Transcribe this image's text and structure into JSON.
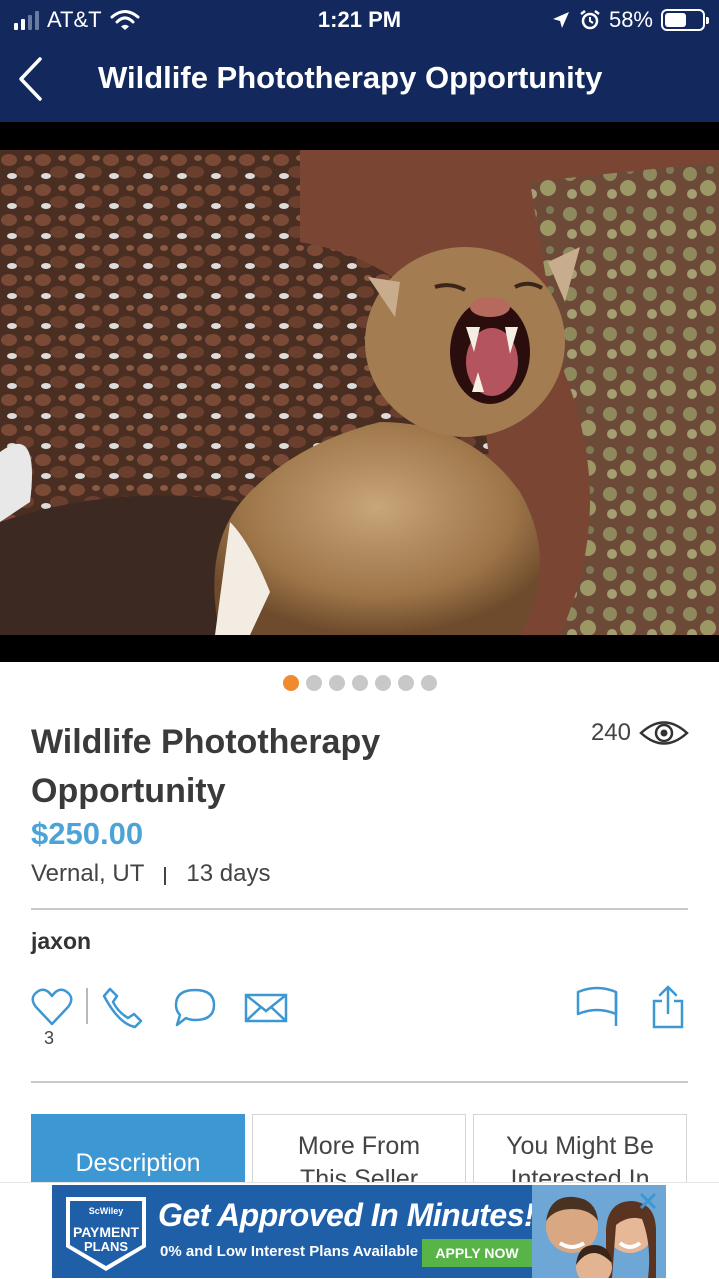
{
  "status_bar": {
    "carrier": "AT&T",
    "time": "1:21 PM",
    "battery": "58%",
    "battery_level": 0.58
  },
  "nav": {
    "title": "Wildlife Phototherapy Opportunity",
    "back_icon": "chevron-left-icon"
  },
  "gallery": {
    "image_count": 7,
    "active_index": 0
  },
  "listing": {
    "title": "Wildlife Phototherapy Opportunity",
    "views": "240",
    "price": "$250.00",
    "location": "Vernal, UT",
    "age": "13 days",
    "seller": "jaxon",
    "favorites": "3"
  },
  "actions": {
    "icons": [
      "heart-icon",
      "phone-icon",
      "chat-icon",
      "mail-icon",
      "flag-icon",
      "share-icon"
    ]
  },
  "tabs": [
    {
      "label": "Description",
      "active": true
    },
    {
      "label": "More From This Seller",
      "active": false
    },
    {
      "label": "You Might Be Interested In",
      "active": false
    }
  ],
  "ad": {
    "logo_top": "ScWiley",
    "logo_line1": "PAYMENT",
    "logo_line2": "PLANS",
    "headline": "Get Approved In Minutes!",
    "subtext": "0% and Low Interest Plans Available",
    "cta": "APPLY NOW"
  },
  "colors": {
    "nav_bg": "#13295e",
    "price": "#4ba3d8",
    "tab_active": "#3d97d3",
    "dot_active": "#ef8a2e"
  }
}
